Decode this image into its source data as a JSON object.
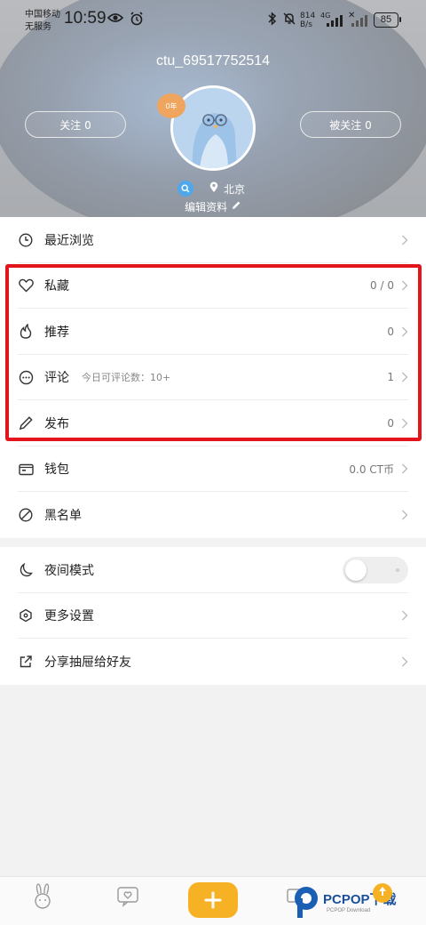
{
  "status_bar": {
    "carrier_line1": "中国移动",
    "carrier_line2": "无服务",
    "time": "10:59",
    "net_speed_value": "814",
    "net_speed_unit": "B/s",
    "network_type": "4G",
    "battery": "85"
  },
  "profile": {
    "username": "ctu_69517752514",
    "follow_label": "关注 0",
    "followers_label": "被关注 0",
    "age_badge": "0年",
    "location": "北京",
    "edit_label": "编辑资料"
  },
  "menu_main": [
    {
      "label": "最近浏览",
      "value": "",
      "sub": ""
    },
    {
      "label": "私藏",
      "value": "0 / 0",
      "sub": ""
    },
    {
      "label": "推荐",
      "value": "0",
      "sub": ""
    },
    {
      "label": "评论",
      "value": "1",
      "sub": "今日可评论数：10+"
    },
    {
      "label": "发布",
      "value": "0",
      "sub": ""
    },
    {
      "label": "钱包",
      "value": "0.0 CT币",
      "sub": ""
    },
    {
      "label": "黑名单",
      "value": "",
      "sub": ""
    }
  ],
  "menu_settings": [
    {
      "label": "夜间模式",
      "toggle_on": false
    },
    {
      "label": "更多设置"
    },
    {
      "label": "分享抽屉给好友"
    }
  ],
  "watermark": {
    "brand": "PCPOP下载",
    "sub": "PCPOP Download"
  },
  "colors": {
    "accent": "#f7b125",
    "highlight_border": "#e3141b",
    "avatar_bg": "#bcd5ef"
  }
}
